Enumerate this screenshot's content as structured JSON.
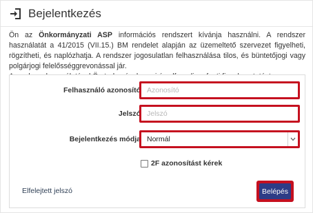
{
  "header": {
    "title": "Bejelentkezés",
    "icon": "login-icon"
  },
  "intro": {
    "lines": [
      {
        "part1": "Ön az ",
        "bold": "Önkormányzati ASP",
        "part2": " információs rendszert kívánja használni. A rendszer használatát a 41/2015 (VII.15.) BM rendelet alapján az üzemeltető szervezet figyelheti, rögzítheti, és naplózhatja. A rendszer jogosulatlan felhasználása tilos, és büntetőjogi vagy polgárjogi felelősséggrevonással jár."
      },
      {
        "text": "A rendszer használatával Ön tudomásul veszi és elfogadja a fenti figyelmeztetést."
      }
    ]
  },
  "form": {
    "username": {
      "label": "Felhasználó azonosító",
      "placeholder": "Azonosító",
      "value": ""
    },
    "password": {
      "label": "Jelszó",
      "placeholder": "Jelszó",
      "value": ""
    },
    "method": {
      "label": "Bejelentkezés módja",
      "selected": "Normál"
    },
    "twofa": {
      "label": "2F azonosítást kérek",
      "checked": false
    },
    "forgot_link": "Elfelejtett jelszó",
    "login_button": "Belépés"
  },
  "colors": {
    "highlight": "#c5101f",
    "button_bg": "#2d3c86",
    "text": "#333333",
    "link": "#2f3f55"
  }
}
